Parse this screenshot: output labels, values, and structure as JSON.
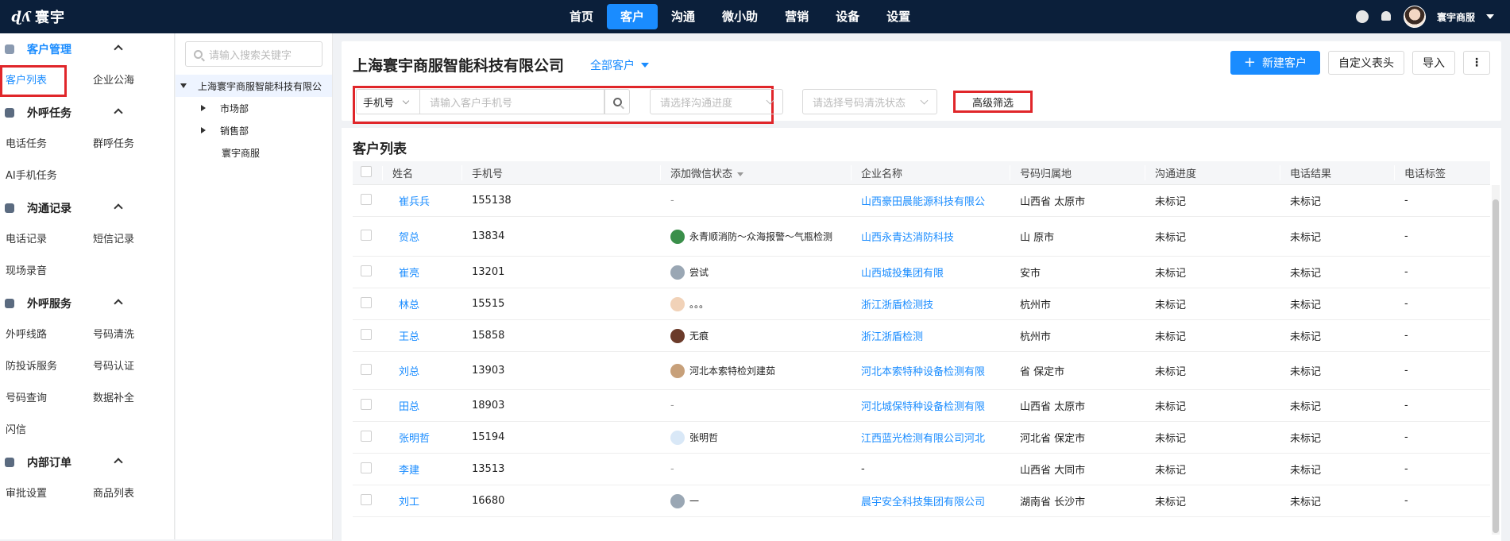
{
  "brand": {
    "mark": "&lt;ʎ",
    "name": "寰宇"
  },
  "nav": [
    {
      "label": "首页",
      "active": false
    },
    {
      "label": "客户",
      "active": true
    },
    {
      "label": "沟通",
      "active": false
    },
    {
      "label": "微小助",
      "active": false
    },
    {
      "label": "营销",
      "active": false
    },
    {
      "label": "设备",
      "active": false
    },
    {
      "label": "设置",
      "active": false
    }
  ],
  "user": {
    "name": "寰宇商服"
  },
  "sidebar": {
    "groups": [
      {
        "title": "客户管理",
        "items": [
          "客户列表",
          "企业公海"
        ]
      },
      {
        "title": "外呼任务",
        "items": [
          "电话任务",
          "群呼任务",
          "AI手机任务"
        ]
      },
      {
        "title": "沟通记录",
        "items": [
          "电话记录",
          "短信记录",
          "现场录音"
        ]
      },
      {
        "title": "外呼服务",
        "items": [
          "外呼线路",
          "号码清洗",
          "防投诉服务",
          "号码认证",
          "号码查询",
          "数据补全",
          "闪信"
        ]
      },
      {
        "title": "内部订单",
        "items": [
          "审批设置",
          "商品列表"
        ]
      }
    ]
  },
  "tree": {
    "search_placeholder": "请输入搜索关键字",
    "root": "上海寰宇商服智能科技有限公",
    "children": [
      "市场部",
      "销售部",
      "寰宇商服"
    ]
  },
  "header": {
    "company": "上海寰宇商服智能科技有限公司",
    "scope": "全部客户",
    "buttons": {
      "new": "新建客户",
      "custom": "自定义表头",
      "import": "导入",
      "more": "⋮"
    }
  },
  "filters": {
    "field": "手机号",
    "phone_placeholder": "请输入客户手机号",
    "progress_placeholder": "请选择沟通进度",
    "clean_placeholder": "请选择号码清洗状态",
    "advanced": "高级筛选"
  },
  "list": {
    "title": "客户列表",
    "columns": [
      "姓名",
      "手机号",
      "添加微信状态",
      "企业名称",
      "号码归属地",
      "沟通进度",
      "电话结果",
      "电话标签"
    ],
    "rows": [
      {
        "name": "崔兵兵",
        "phone": "155138",
        "wx": "-",
        "company": "山西豪田晨能源科技有限公",
        "loc": "山西省 太原市",
        "progress": "未标记",
        "result": "未标记",
        "tag": "-"
      },
      {
        "name": "贺总",
        "phone": "13834",
        "wx": "永青顺消防～众海报警～气瓶检测",
        "company": "山西永青达消防科技",
        "loc": "山 原市",
        "progress": "未标记",
        "result": "未标记",
        "tag": "-"
      },
      {
        "name": "崔亮",
        "phone": "13201",
        "wx": "尝试",
        "company": "山西城投集团有限",
        "loc": "安市",
        "progress": "未标记",
        "result": "未标记",
        "tag": "-"
      },
      {
        "name": "林总",
        "phone": "15515",
        "wx": "。。。",
        "company": "浙江浙盾检测技",
        "loc": "杭州市",
        "progress": "未标记",
        "result": "未标记",
        "tag": "-"
      },
      {
        "name": "王总",
        "phone": "15858",
        "wx": "无痕",
        "company": "浙江浙盾检测",
        "loc": "杭州市",
        "progress": "未标记",
        "result": "未标记",
        "tag": "-"
      },
      {
        "name": "刘总",
        "phone": "13903",
        "wx": "河北本索特检刘建茹",
        "company": "河北本索特种设备检测有限",
        "loc": "省 保定市",
        "progress": "未标记",
        "result": "未标记",
        "tag": "-"
      },
      {
        "name": "田总",
        "phone": "18903",
        "wx": "-",
        "company": "河北城保特种设备检测有限",
        "loc": "山西省 太原市",
        "progress": "未标记",
        "result": "未标记",
        "tag": "-"
      },
      {
        "name": "张明哲",
        "phone": "15194",
        "wx": "张明哲",
        "company": "江西蓝光检测有限公司河北",
        "loc": "河北省 保定市",
        "progress": "未标记",
        "result": "未标记",
        "tag": "-"
      },
      {
        "name": "李建",
        "phone": "13513",
        "wx": "-",
        "company": "-",
        "loc": "山西省 大同市",
        "progress": "未标记",
        "result": "未标记",
        "tag": "-"
      },
      {
        "name": "刘工",
        "phone": "16680",
        "wx": "一",
        "company": "晨宇安全科技集团有限公司",
        "loc": "湖南省 长沙市",
        "progress": "未标记",
        "result": "未标记",
        "tag": "-"
      }
    ]
  }
}
